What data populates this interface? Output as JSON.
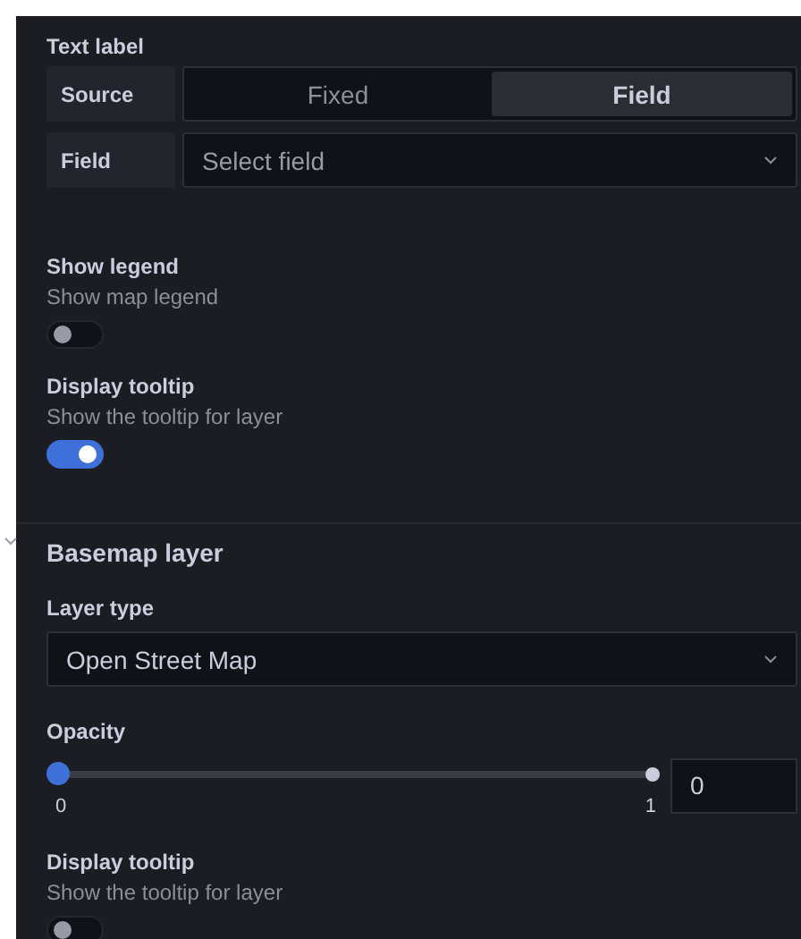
{
  "text_label": {
    "title": "Text label",
    "source": {
      "label": "Source",
      "options": [
        {
          "label": "Fixed",
          "selected": false
        },
        {
          "label": "Field",
          "selected": true
        }
      ]
    },
    "field": {
      "label": "Field",
      "placeholder": "Select field"
    }
  },
  "show_legend": {
    "title": "Show legend",
    "description": "Show map legend",
    "on": false
  },
  "display_tooltip": {
    "title": "Display tooltip",
    "description": "Show the tooltip for layer",
    "on": true
  },
  "basemap_layer": {
    "title": "Basemap layer",
    "expanded": true,
    "layer_type": {
      "label": "Layer type",
      "value": "Open Street Map"
    },
    "opacity": {
      "label": "Opacity",
      "level": 0,
      "min_label": "0",
      "max_label": "1",
      "value": "0"
    },
    "display_tooltip": {
      "title": "Display tooltip",
      "description": "Show the tooltip for layer",
      "on": false
    }
  }
}
